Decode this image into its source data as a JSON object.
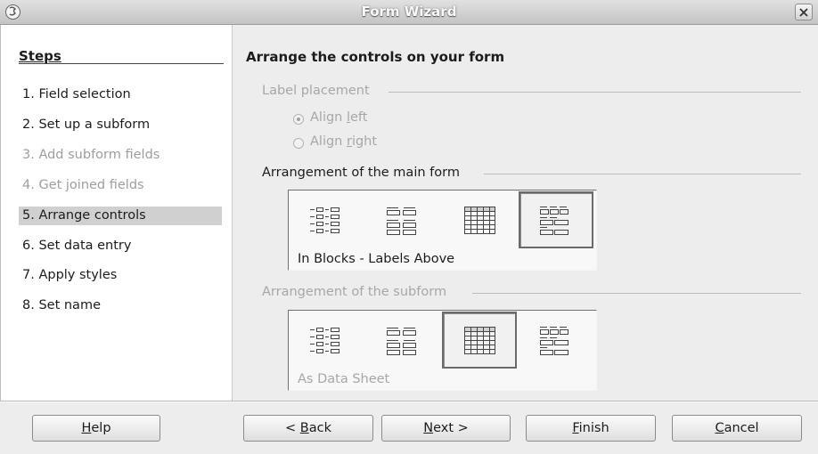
{
  "window": {
    "title": "Form Wizard"
  },
  "steps": {
    "header": "Steps",
    "items": [
      {
        "label": "1. Field selection",
        "state": "enabled"
      },
      {
        "label": "2. Set up a subform",
        "state": "enabled"
      },
      {
        "label": "3. Add subform fields",
        "state": "disabled"
      },
      {
        "label": "4. Get joined fields",
        "state": "disabled"
      },
      {
        "label": "5. Arrange controls",
        "state": "active"
      },
      {
        "label": "6. Set data entry",
        "state": "enabled"
      },
      {
        "label": "7. Apply styles",
        "state": "enabled"
      },
      {
        "label": "8. Set name",
        "state": "enabled"
      }
    ]
  },
  "main": {
    "title": "Arrange the controls on your form",
    "label_placement": {
      "label": "Label placement",
      "align_left": {
        "pre": "Align ",
        "mnemonic": "l",
        "post": "eft",
        "checked": true
      },
      "align_right": {
        "pre": "Align ",
        "mnemonic": "r",
        "post": "ight",
        "checked": false
      }
    },
    "main_arrangement": {
      "label": "Arrangement of the main form",
      "caption": "In Blocks - Labels Above",
      "selected": "in-blocks-labels-above"
    },
    "sub_arrangement": {
      "label": "Arrangement of the subform",
      "caption": "As Data Sheet",
      "selected": "as-data-sheet"
    }
  },
  "buttons": {
    "help": {
      "pre": "",
      "mnemonic": "H",
      "post": "elp"
    },
    "back": {
      "pre": "< ",
      "mnemonic": "B",
      "post": "ack"
    },
    "next": {
      "pre": "",
      "mnemonic": "N",
      "post": "ext >"
    },
    "finish": {
      "pre": "",
      "mnemonic": "F",
      "post": "inish"
    },
    "cancel": {
      "pre": "",
      "mnemonic": "C",
      "post": "ancel"
    }
  },
  "colors": {
    "dialog_bg": "#ededed",
    "steps_bg": "#ffffff",
    "active_step": "#d0d0d0",
    "disabled_text": "#9d9d9d"
  }
}
